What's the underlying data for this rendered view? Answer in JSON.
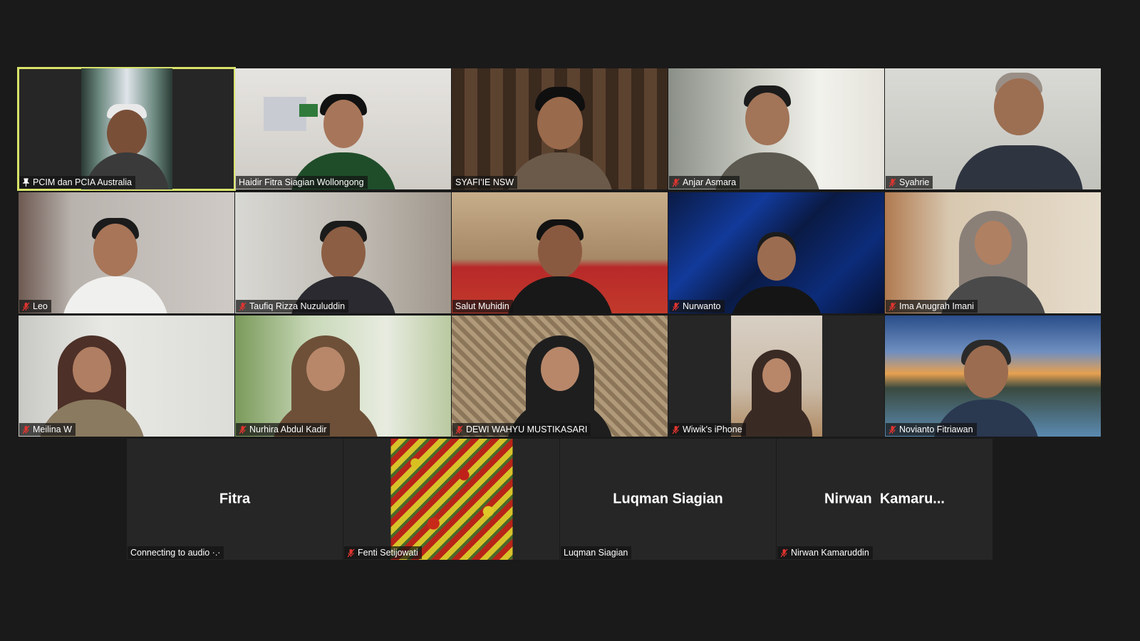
{
  "meeting": {
    "active_speaker": "PCIM dan PCIA Australia",
    "participants": [
      {
        "name": "PCIM dan PCIA Australia",
        "muted": false,
        "pinned": true
      },
      {
        "name": "Haidir Fitra Siagian Wollongong",
        "muted": false
      },
      {
        "name": "SYAFI'IE NSW",
        "muted": false
      },
      {
        "name": "Anjar Asmara",
        "muted": true
      },
      {
        "name": "Syahrie",
        "muted": true
      },
      {
        "name": "Leo",
        "muted": true
      },
      {
        "name": "Taufiq Rizza Nuzuluddin",
        "muted": true
      },
      {
        "name": "Salut Muhidin",
        "muted": false
      },
      {
        "name": "Nurwanto",
        "muted": true
      },
      {
        "name": "Ima Anugrah Imani",
        "muted": true
      },
      {
        "name": "Meilina W",
        "muted": true
      },
      {
        "name": "Nurhira Abdul Kadir",
        "muted": true
      },
      {
        "name": "DEWI WAHYU MUSTIKASARI",
        "muted": true
      },
      {
        "name": "Wiwik's iPhone",
        "muted": true
      },
      {
        "name": "Novianto Fitriawan",
        "muted": true
      },
      {
        "name": "Connecting to audio ·.·",
        "display_name": "Fitra",
        "muted": false
      },
      {
        "name": "Fenti Setijowati",
        "muted": true
      },
      {
        "name": "Luqman Siagian",
        "display_name": "Luqman Siagian",
        "muted": false
      },
      {
        "name": "Nirwan Kamaruddin",
        "display_name": "Nirwan  Kamaru...",
        "muted": true
      }
    ]
  },
  "colors": {
    "background": "#1a1a1a",
    "tile": "#262626",
    "active_border": "#d8e36a",
    "muted_icon": "#e0342f"
  },
  "icons": {
    "muted": "mic-muted-icon",
    "pinned": "pin-icon"
  }
}
